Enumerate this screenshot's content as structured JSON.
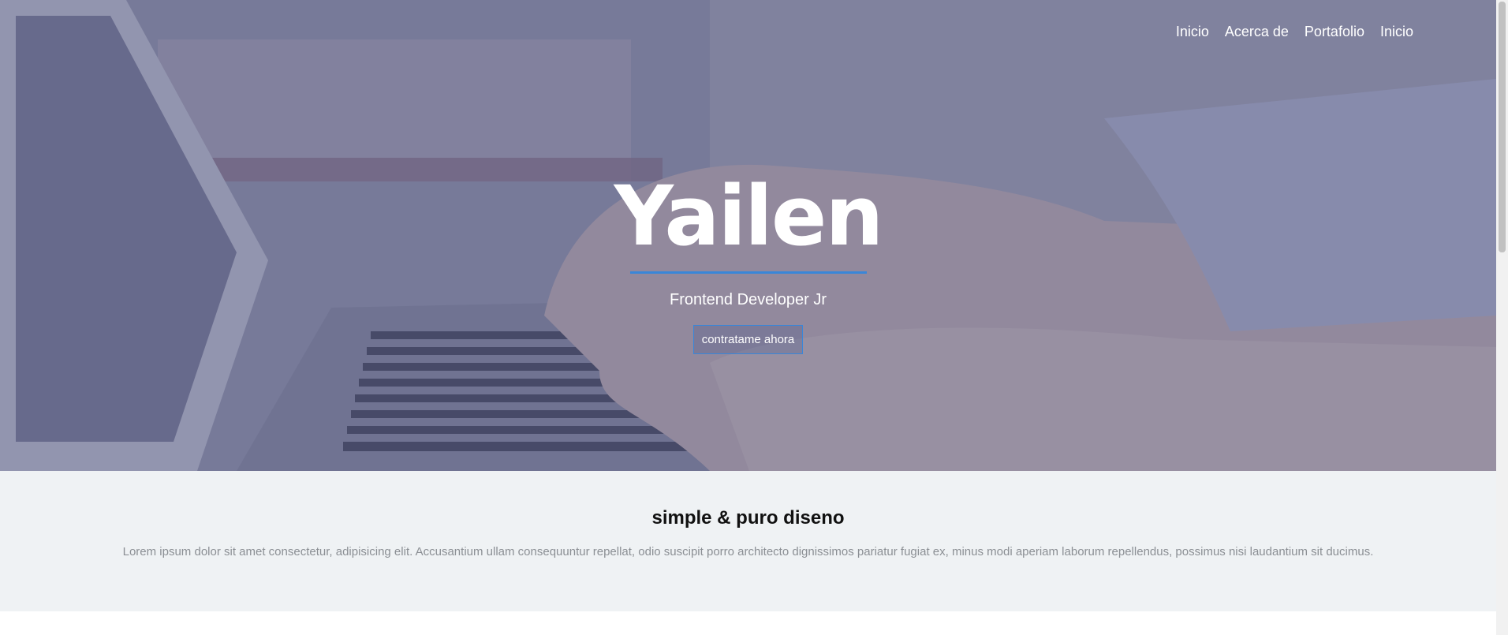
{
  "nav": {
    "items": [
      "Inicio",
      "Acerca de",
      "Portafolio",
      "Inicio"
    ]
  },
  "hero": {
    "title": "Yailen",
    "subtitle": "Frontend Developer Jr",
    "cta_label": "contratame ahora",
    "accent_color": "#3a86d8"
  },
  "section": {
    "title": "simple & puro diseno",
    "text": "Lorem ipsum dolor sit amet consectetur, adipisicing elit. Accusantium ullam consequuntur repellat, odio suscipit porro architecto dignissimos pariatur fugiat ex, minus modi aperiam laborum repellendus, possimus nisi laudantium sit ducimus."
  }
}
